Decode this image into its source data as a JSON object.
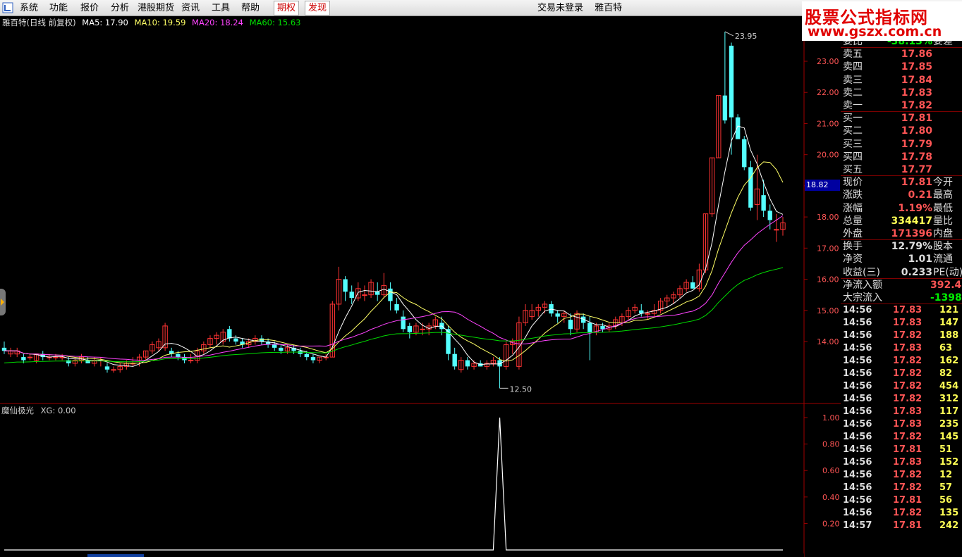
{
  "menu": {
    "items": [
      "系统",
      "功能",
      "报价",
      "分析",
      "港股期货",
      "资讯",
      "工具",
      "帮助"
    ],
    "highlight_items": [
      "期权",
      "发现"
    ],
    "trade_status": "交易未登录",
    "stock_title": "雅百特"
  },
  "watermark": {
    "line1": "股票公式指标网",
    "line2": "www.gszx.com.cn"
  },
  "chart": {
    "header": {
      "name": "雅百特(日线 前复权)",
      "ma5": "MA5: 17.90",
      "ma10": "MA10: 19.59",
      "ma20": "MA20: 18.24",
      "ma60": "MA60: 15.63",
      "colors": {
        "ma5": "#ffffff",
        "ma10": "#ffff66",
        "ma20": "#ff44ff",
        "ma60": "#00dd00"
      }
    },
    "price_axis": [
      "23.00",
      "22.00",
      "21.00",
      "20.00",
      "19.00",
      "18.00",
      "17.00",
      "16.00",
      "15.00",
      "14.00"
    ],
    "current_price_label": "18.82",
    "high_label": "23.95",
    "low_label": "12.50",
    "indicator": {
      "name": "魔仙极光",
      "value": "XG: 0.00",
      "axis": [
        "1.00",
        "0.80",
        "0.60",
        "0.40",
        "0.20"
      ]
    }
  },
  "chart_data": {
    "type": "candlestick",
    "ylim": [
      12.2,
      24.2
    ],
    "candles": [
      [
        13.8,
        14.0,
        13.6,
        13.7
      ],
      [
        13.6,
        13.8,
        13.5,
        13.7
      ],
      [
        13.6,
        13.8,
        13.5,
        13.7
      ],
      [
        13.5,
        13.6,
        13.3,
        13.4
      ],
      [
        13.5,
        13.6,
        13.4,
        13.5
      ],
      [
        13.4,
        13.6,
        13.3,
        13.6
      ],
      [
        13.6,
        13.7,
        13.4,
        13.5
      ],
      [
        13.5,
        13.6,
        13.4,
        13.5
      ],
      [
        13.5,
        13.6,
        13.4,
        13.5
      ],
      [
        13.5,
        13.6,
        13.4,
        13.5
      ],
      [
        13.4,
        13.5,
        13.2,
        13.3
      ],
      [
        13.3,
        13.5,
        13.2,
        13.4
      ],
      [
        13.4,
        13.6,
        13.3,
        13.5
      ],
      [
        13.4,
        13.5,
        13.3,
        13.3
      ],
      [
        13.3,
        13.5,
        13.2,
        13.4
      ],
      [
        13.4,
        13.5,
        13.2,
        13.4
      ],
      [
        13.2,
        13.3,
        13.0,
        13.1
      ],
      [
        13.1,
        13.2,
        13.0,
        13.1
      ],
      [
        13.1,
        13.3,
        13.0,
        13.2
      ],
      [
        13.2,
        13.4,
        13.1,
        13.3
      ],
      [
        13.3,
        13.5,
        13.2,
        13.3
      ],
      [
        13.4,
        13.6,
        13.2,
        13.5
      ],
      [
        13.5,
        13.7,
        13.4,
        13.7
      ],
      [
        13.7,
        14.0,
        13.6,
        13.9
      ],
      [
        13.8,
        14.1,
        13.7,
        14.0
      ],
      [
        13.8,
        14.6,
        13.7,
        14.5
      ],
      [
        13.7,
        13.8,
        13.5,
        13.6
      ],
      [
        13.6,
        13.7,
        13.4,
        13.5
      ],
      [
        13.5,
        13.6,
        13.3,
        13.4
      ],
      [
        13.4,
        13.6,
        13.3,
        13.4
      ],
      [
        13.4,
        13.8,
        13.3,
        13.7
      ],
      [
        13.7,
        14.0,
        13.6,
        13.9
      ],
      [
        13.9,
        14.2,
        13.8,
        14.1
      ],
      [
        14.1,
        14.3,
        13.9,
        14.2
      ],
      [
        14.0,
        14.4,
        13.9,
        14.3
      ],
      [
        14.4,
        14.5,
        14.0,
        14.1
      ],
      [
        14.1,
        14.2,
        13.9,
        14.0
      ],
      [
        14.0,
        14.1,
        13.8,
        13.9
      ],
      [
        13.9,
        14.1,
        13.8,
        14.0
      ],
      [
        14.0,
        14.2,
        13.9,
        14.1
      ],
      [
        14.1,
        14.2,
        13.9,
        14.0
      ],
      [
        14.0,
        14.1,
        13.8,
        13.9
      ],
      [
        13.9,
        14.0,
        13.7,
        13.8
      ],
      [
        13.8,
        13.9,
        13.6,
        13.7
      ],
      [
        13.7,
        13.9,
        13.6,
        13.8
      ],
      [
        13.8,
        13.9,
        13.6,
        13.7
      ],
      [
        13.7,
        13.8,
        13.5,
        13.6
      ],
      [
        13.6,
        13.7,
        13.4,
        13.5
      ],
      [
        13.5,
        13.6,
        13.3,
        13.4
      ],
      [
        13.4,
        13.5,
        13.3,
        13.5
      ],
      [
        13.5,
        13.6,
        13.4,
        13.5
      ],
      [
        13.5,
        15.3,
        13.5,
        15.2
      ],
      [
        15.2,
        16.4,
        15.0,
        16.0
      ],
      [
        16.0,
        16.1,
        15.3,
        15.6
      ],
      [
        15.6,
        15.8,
        15.2,
        15.4
      ],
      [
        15.4,
        15.9,
        15.3,
        15.7
      ],
      [
        15.5,
        15.8,
        15.3,
        15.5
      ],
      [
        15.5,
        16.0,
        15.4,
        15.9
      ],
      [
        15.6,
        15.9,
        15.3,
        15.5
      ],
      [
        15.5,
        16.2,
        15.4,
        15.8
      ],
      [
        15.7,
        15.9,
        15.0,
        15.3
      ],
      [
        15.2,
        15.4,
        14.9,
        15.0
      ],
      [
        14.8,
        15.0,
        14.3,
        14.4
      ],
      [
        14.5,
        14.6,
        14.1,
        14.3
      ],
      [
        14.3,
        14.6,
        14.2,
        14.5
      ],
      [
        14.4,
        14.6,
        14.2,
        14.4
      ],
      [
        14.4,
        14.6,
        14.2,
        14.5
      ],
      [
        14.5,
        14.8,
        14.4,
        14.7
      ],
      [
        14.6,
        14.8,
        14.2,
        14.4
      ],
      [
        14.4,
        14.5,
        13.4,
        13.6
      ],
      [
        13.6,
        13.8,
        13.1,
        13.2
      ],
      [
        13.1,
        13.5,
        13.0,
        13.4
      ],
      [
        13.4,
        13.5,
        13.1,
        13.2
      ],
      [
        13.2,
        13.4,
        13.1,
        13.3
      ],
      [
        13.3,
        13.4,
        13.2,
        13.2
      ],
      [
        13.2,
        13.4,
        13.1,
        13.3
      ],
      [
        13.3,
        13.5,
        13.2,
        13.4
      ],
      [
        13.4,
        13.5,
        12.5,
        13.2
      ],
      [
        13.2,
        14.0,
        13.1,
        13.9
      ],
      [
        13.9,
        14.1,
        13.6,
        14.0
      ],
      [
        13.2,
        14.8,
        13.1,
        14.6
      ],
      [
        14.6,
        15.2,
        14.5,
        15.0
      ],
      [
        14.8,
        15.2,
        14.7,
        15.0
      ],
      [
        15.0,
        15.2,
        14.8,
        15.1
      ],
      [
        15.1,
        15.3,
        14.9,
        15.2
      ],
      [
        15.2,
        15.3,
        14.8,
        14.9
      ],
      [
        14.9,
        15.0,
        14.6,
        14.8
      ],
      [
        14.8,
        15.0,
        14.6,
        14.9
      ],
      [
        14.7,
        14.9,
        14.2,
        14.4
      ],
      [
        14.4,
        15.0,
        14.3,
        14.9
      ],
      [
        14.8,
        14.9,
        14.4,
        14.6
      ],
      [
        14.6,
        14.8,
        13.4,
        14.3
      ],
      [
        14.3,
        14.6,
        14.2,
        14.5
      ],
      [
        14.5,
        14.6,
        14.3,
        14.4
      ],
      [
        14.4,
        14.6,
        14.3,
        14.5
      ],
      [
        14.5,
        14.8,
        14.4,
        14.7
      ],
      [
        14.6,
        14.9,
        14.5,
        14.8
      ],
      [
        14.8,
        15.1,
        14.7,
        15.0
      ],
      [
        15.0,
        15.2,
        14.9,
        15.1
      ],
      [
        15.0,
        15.2,
        14.8,
        14.9
      ],
      [
        14.9,
        15.0,
        14.7,
        14.9
      ],
      [
        14.9,
        15.2,
        14.8,
        15.0
      ],
      [
        15.0,
        15.4,
        14.9,
        15.3
      ],
      [
        15.3,
        15.5,
        15.1,
        15.4
      ],
      [
        15.4,
        15.6,
        15.2,
        15.5
      ],
      [
        15.5,
        15.8,
        15.4,
        15.7
      ],
      [
        15.7,
        16.0,
        15.6,
        15.9
      ],
      [
        15.9,
        16.1,
        15.7,
        15.7
      ],
      [
        15.7,
        16.5,
        15.6,
        16.3
      ],
      [
        16.3,
        18.1,
        16.2,
        18.1
      ],
      [
        18.1,
        19.9,
        18.0,
        19.9
      ],
      [
        19.9,
        21.9,
        19.9,
        21.9
      ],
      [
        21.9,
        23.95,
        21.0,
        21.1
      ],
      [
        23.5,
        23.6,
        20.0,
        21.2
      ],
      [
        21.2,
        21.3,
        20.5,
        20.5
      ],
      [
        20.5,
        20.6,
        19.5,
        19.6
      ],
      [
        19.6,
        19.8,
        18.2,
        18.3
      ],
      [
        18.4,
        20.0,
        17.9,
        18.9
      ],
      [
        18.7,
        19.2,
        18.0,
        18.2
      ],
      [
        18.2,
        18.4,
        17.6,
        17.9
      ],
      [
        17.6,
        18.1,
        17.2,
        17.6
      ],
      [
        17.6,
        18.0,
        17.4,
        17.81
      ]
    ],
    "indicator_series": {
      "name": "XG",
      "spike_index": 77,
      "spike_value": 1.0,
      "baseline": 0.0
    }
  },
  "quote": {
    "top_partial": {
      "label": "委比",
      "value": "-38.13%",
      "label2": "委差"
    },
    "asks": [
      {
        "label": "卖五",
        "price": "17.86"
      },
      {
        "label": "卖四",
        "price": "17.85"
      },
      {
        "label": "卖三",
        "price": "17.84"
      },
      {
        "label": "卖二",
        "price": "17.83"
      },
      {
        "label": "卖一",
        "price": "17.82"
      }
    ],
    "bids": [
      {
        "label": "买一",
        "price": "17.81"
      },
      {
        "label": "买二",
        "price": "17.80"
      },
      {
        "label": "买三",
        "price": "17.79"
      },
      {
        "label": "买四",
        "price": "17.78"
      },
      {
        "label": "买五",
        "price": "17.77"
      }
    ],
    "stats1": [
      {
        "label": "现价",
        "value": "17.81",
        "label2": "今开",
        "color": "#ff5555"
      },
      {
        "label": "涨跌",
        "value": "0.21",
        "label2": "最高",
        "color": "#ff5555"
      },
      {
        "label": "涨幅",
        "value": "1.19%",
        "label2": "最低",
        "color": "#ff5555"
      },
      {
        "label": "总量",
        "value": "334417",
        "label2": "量比",
        "color": "#ffff55"
      },
      {
        "label": "外盘",
        "value": "171396",
        "label2": "内盘",
        "color": "#ff5555"
      }
    ],
    "stats2": [
      {
        "label": "换手",
        "value": "12.79%",
        "label2": "股本",
        "color": "#dddddd"
      },
      {
        "label": "净资",
        "value": "1.01",
        "label2": "流通",
        "color": "#dddddd"
      },
      {
        "label": "收益(三)",
        "value": "0.233",
        "label2": "PE(动)",
        "color": "#dddddd"
      }
    ],
    "flow": [
      {
        "label": "净流入额",
        "value": "392.4",
        "color": "#ff5555"
      },
      {
        "label": "大宗流入",
        "value": "-1398",
        "color": "#00ee00"
      }
    ],
    "ticks": [
      [
        "14:56",
        "17.83",
        "121"
      ],
      [
        "14:56",
        "17.83",
        "147"
      ],
      [
        "14:56",
        "17.82",
        "188"
      ],
      [
        "14:56",
        "17.83",
        "63"
      ],
      [
        "14:56",
        "17.82",
        "162"
      ],
      [
        "14:56",
        "17.82",
        "82"
      ],
      [
        "14:56",
        "17.82",
        "454"
      ],
      [
        "14:56",
        "17.82",
        "312"
      ],
      [
        "14:56",
        "17.83",
        "117"
      ],
      [
        "14:56",
        "17.83",
        "235"
      ],
      [
        "14:56",
        "17.82",
        "145"
      ],
      [
        "14:56",
        "17.81",
        "51"
      ],
      [
        "14:56",
        "17.83",
        "152"
      ],
      [
        "14:56",
        "17.82",
        "12"
      ],
      [
        "14:56",
        "17.82",
        "57"
      ],
      [
        "14:56",
        "17.81",
        "56"
      ],
      [
        "14:56",
        "17.82",
        "135"
      ],
      [
        "14:57",
        "17.81",
        "242"
      ]
    ]
  }
}
